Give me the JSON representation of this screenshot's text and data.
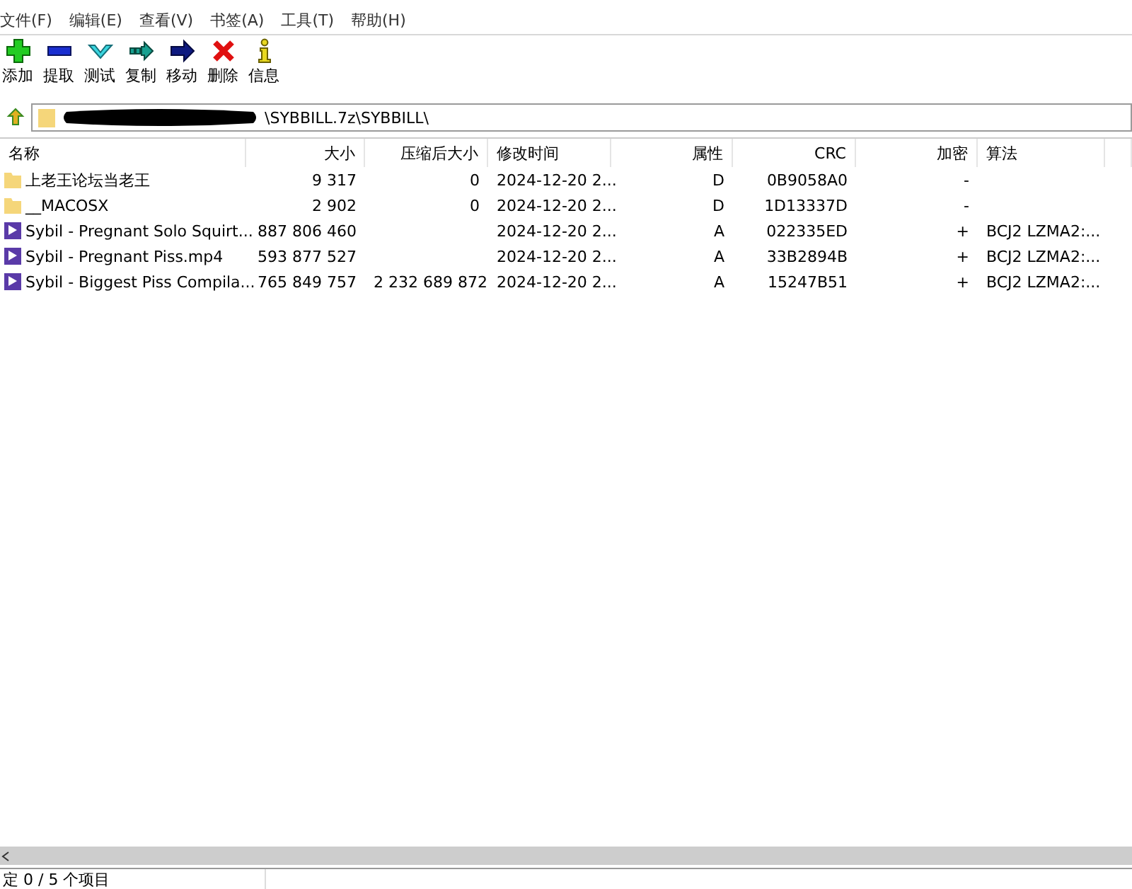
{
  "menu": [
    "文件(F)",
    "编辑(E)",
    "查看(V)",
    "书签(A)",
    "工具(T)",
    "帮助(H)"
  ],
  "toolbar": [
    {
      "kind": "add",
      "label": "添加"
    },
    {
      "kind": "extract",
      "label": "提取"
    },
    {
      "kind": "test",
      "label": "测试"
    },
    {
      "kind": "copy",
      "label": "复制"
    },
    {
      "kind": "move",
      "label": "移动"
    },
    {
      "kind": "delete",
      "label": "删除"
    },
    {
      "kind": "info",
      "label": "信息"
    }
  ],
  "address": {
    "value": "\\SYBBILL.7z\\SYBBILL\\"
  },
  "table": {
    "columns": [
      "名称",
      "大小",
      "压缩后大小",
      "修改时间",
      "属性",
      "CRC",
      "加密",
      "算法"
    ],
    "rows": [
      {
        "kind": "folder",
        "cells": [
          "上老王论坛当老王",
          "9 317",
          "0",
          "2024-12-20 2...",
          "D",
          "0B9058A0",
          "-",
          ""
        ]
      },
      {
        "kind": "folder",
        "cells": [
          "__MACOSX",
          "2 902",
          "0",
          "2024-12-20 2...",
          "D",
          "1D13337D",
          "-",
          ""
        ]
      },
      {
        "kind": "video",
        "cells": [
          "Sybil - Pregnant Solo Squirt...",
          "887 806 460",
          "",
          "2024-12-20 2...",
          "A",
          "022335ED",
          "+",
          "BCJ2 LZMA2:..."
        ]
      },
      {
        "kind": "video",
        "cells": [
          "Sybil - Pregnant Piss.mp4",
          "593 877 527",
          "",
          "2024-12-20 2...",
          "A",
          "33B2894B",
          "+",
          "BCJ2 LZMA2:..."
        ]
      },
      {
        "kind": "video",
        "cells": [
          "Sybil - Biggest Piss Compila...",
          "765 849 757",
          "2 232 689 872",
          "2024-12-20 2...",
          "A",
          "15247B51",
          "+",
          "BCJ2 LZMA2:..."
        ]
      }
    ]
  },
  "status_bar": [
    "定 0 / 5 个项目"
  ]
}
